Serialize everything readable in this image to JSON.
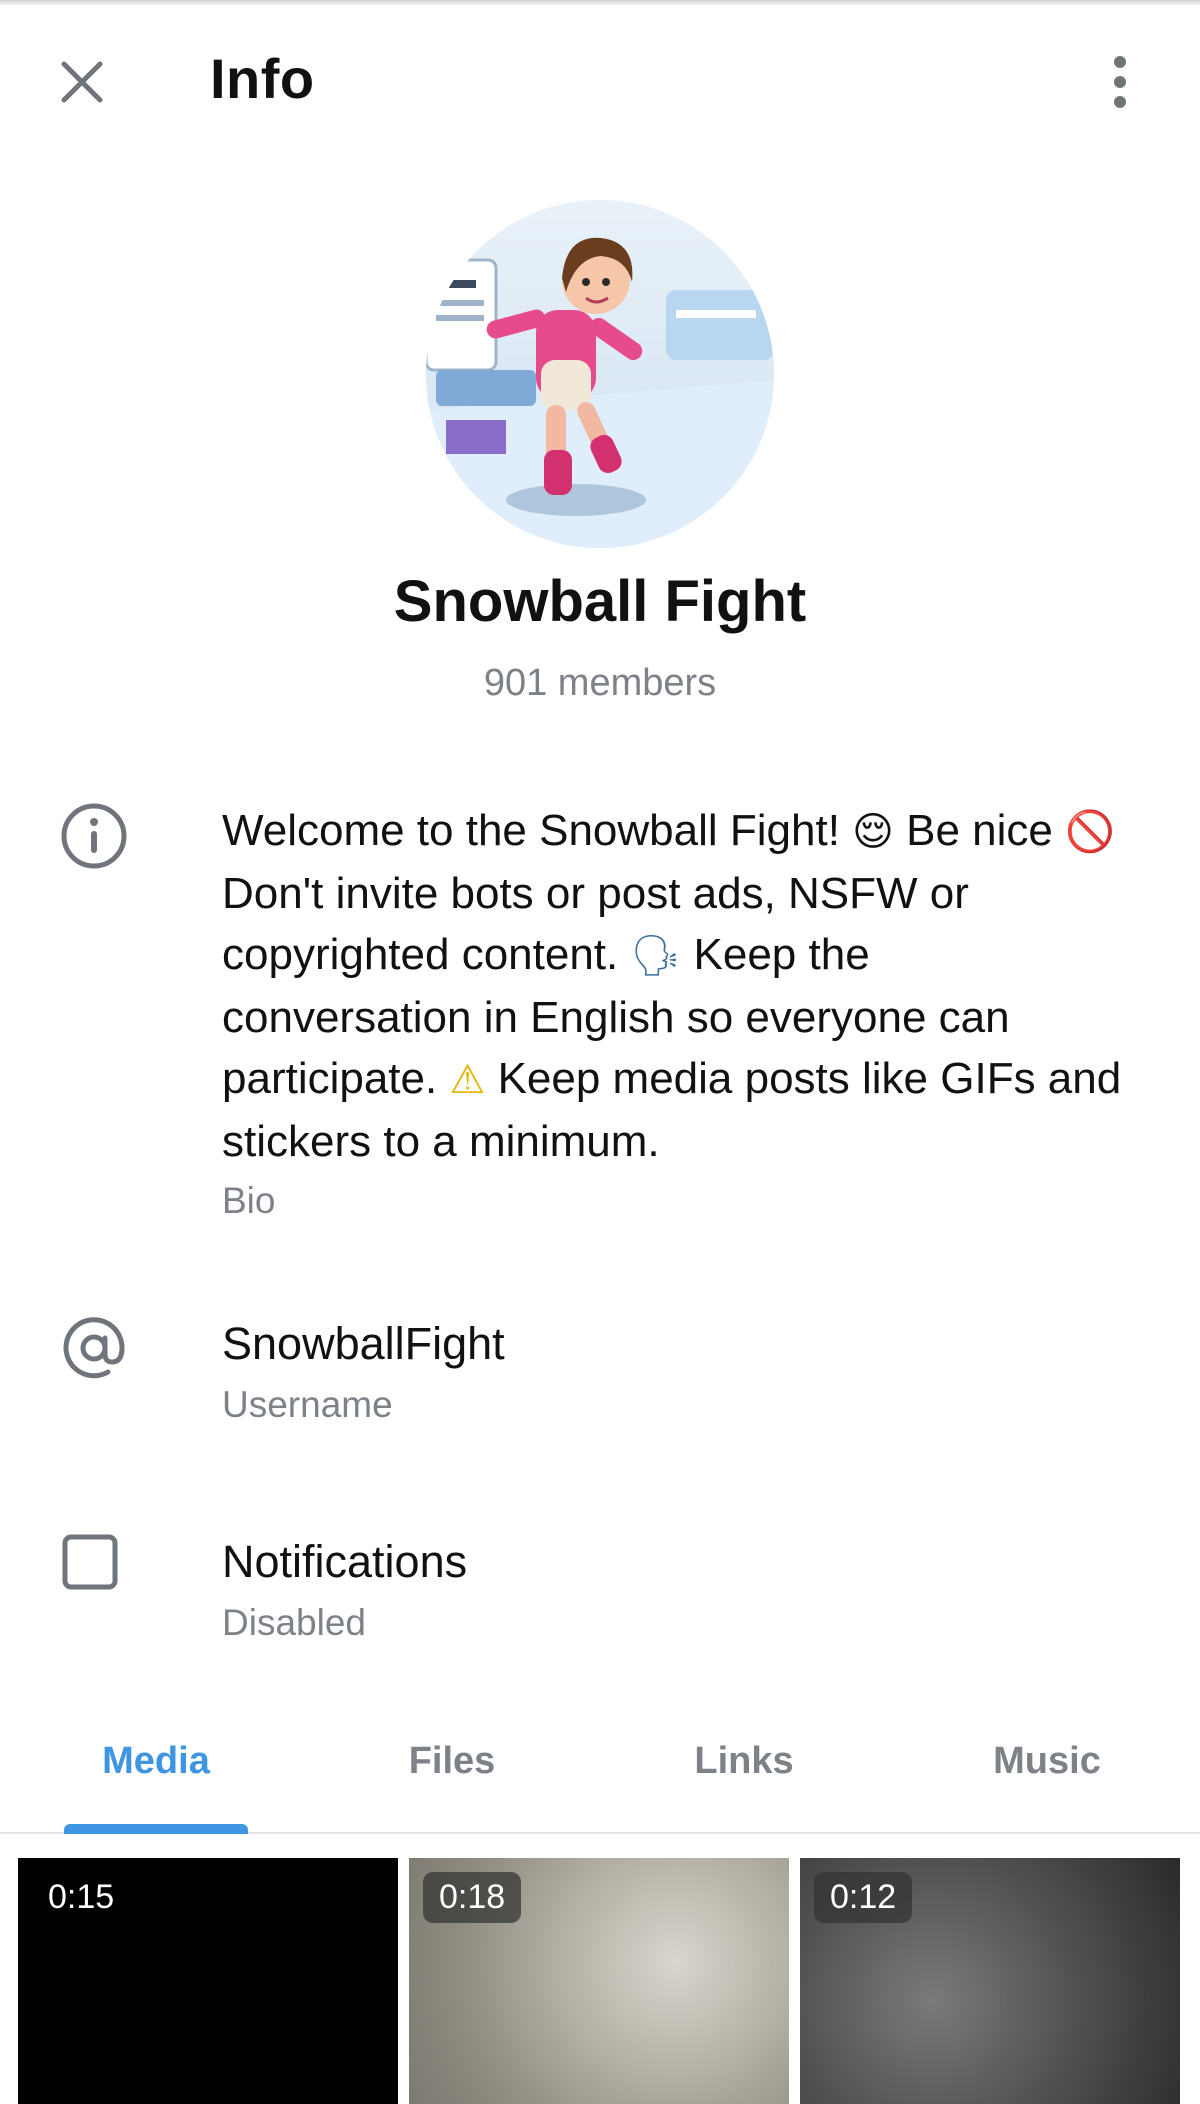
{
  "header": {
    "title": "Info",
    "close_icon": "close-icon",
    "menu_icon": "more-vert-icon"
  },
  "profile": {
    "name": "Snowball Fight",
    "members": "901 members"
  },
  "bio": {
    "icon": "info-icon",
    "segments": {
      "s1": "Welcome to the Snowball Fight!",
      "e1": "😌",
      "s2": "Be nice",
      "e2": "🚫",
      "s3": "Don't invite bots or post ads, NSFW or copyrighted content.",
      "e3": "🗣",
      "s4": "Keep the conversation in English so everyone can participate.",
      "e4": "⚠",
      "s5": "Keep media posts like GIFs and stickers to a minimum."
    },
    "label": "Bio"
  },
  "username": {
    "icon": "at-icon",
    "value": "SnowballFight",
    "label": "Username"
  },
  "notifications": {
    "icon": "checkbox-icon",
    "value": "Notifications",
    "label": "Disabled",
    "checked": false
  },
  "tabs": [
    {
      "label": "Media",
      "active": true
    },
    {
      "label": "Files",
      "active": false
    },
    {
      "label": "Links",
      "active": false
    },
    {
      "label": "Music",
      "active": false
    }
  ],
  "media": [
    {
      "duration": "0:15"
    },
    {
      "duration": "0:18"
    },
    {
      "duration": "0:12"
    }
  ],
  "colors": {
    "accent": "#3e95e1",
    "secondary_text": "#7c8287"
  }
}
